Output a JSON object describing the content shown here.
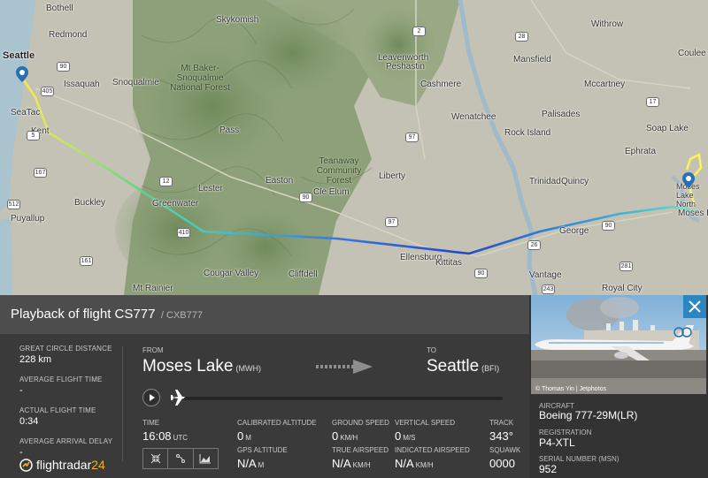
{
  "map": {
    "cities": [
      {
        "name": "Bothell",
        "cls": "city"
      },
      {
        "name": "Skykomish",
        "cls": "city"
      },
      {
        "name": "Redmond",
        "cls": "city"
      },
      {
        "name": "Seattle",
        "cls": "city big"
      },
      {
        "name": "Issaquah",
        "cls": "city"
      },
      {
        "name": "Snoqualmie",
        "cls": "city"
      },
      {
        "name": "SeaTac",
        "cls": "city"
      },
      {
        "name": "Kent",
        "cls": "city"
      },
      {
        "name": "Leavenworth",
        "cls": "city"
      },
      {
        "name": "Peshastin",
        "cls": "city"
      },
      {
        "name": "Cashmere",
        "cls": "city"
      },
      {
        "name": "Wenatchee",
        "cls": "city"
      },
      {
        "name": "Rock Island",
        "cls": "city"
      },
      {
        "name": "Palisades",
        "cls": "city"
      },
      {
        "name": "Withrow",
        "cls": "city"
      },
      {
        "name": "Mansfield",
        "cls": "city"
      },
      {
        "name": "Mccartney",
        "cls": "city"
      },
      {
        "name": "Soap Lake",
        "cls": "city"
      },
      {
        "name": "Coulee Cit",
        "cls": "city"
      },
      {
        "name": "Ephrata",
        "cls": "city"
      },
      {
        "name": "Trinidad",
        "cls": "city"
      },
      {
        "name": "Quincy",
        "cls": "city"
      },
      {
        "name": "Moses Lake",
        "cls": "city"
      },
      {
        "name": "Moses Lake North",
        "cls": "city"
      },
      {
        "name": "Puyallup",
        "cls": "city"
      },
      {
        "name": "Buckley",
        "cls": "city"
      },
      {
        "name": "Greenwater",
        "cls": "city"
      },
      {
        "name": "Easton",
        "cls": "city"
      },
      {
        "name": "Cle Elum",
        "cls": "city"
      },
      {
        "name": "Liberty",
        "cls": "city"
      },
      {
        "name": "Ellensburg",
        "cls": "city"
      },
      {
        "name": "Kittitas",
        "cls": "city"
      },
      {
        "name": "George",
        "cls": "city"
      },
      {
        "name": "Cougar Valley",
        "cls": "city"
      },
      {
        "name": "Cliffdell",
        "cls": "city"
      },
      {
        "name": "Mt Rainier",
        "cls": "city"
      },
      {
        "name": "Vantage",
        "cls": "city"
      },
      {
        "name": "Royal City",
        "cls": "city"
      },
      {
        "name": "Pass",
        "cls": "city"
      },
      {
        "name": "Lester",
        "cls": "city"
      }
    ],
    "forests": [
      {
        "name": "Mt Baker-Snoqualmie National Forest"
      },
      {
        "name": "Teanaway Community Forest"
      }
    ],
    "highways": [
      "90",
      "405",
      "167",
      "512",
      "410",
      "161",
      "2",
      "97",
      "28",
      "17",
      "90",
      "90",
      "281",
      "243",
      "90",
      "12",
      "5",
      "97",
      "26"
    ]
  },
  "flight": {
    "title": "Playback of flight CS777",
    "subtitle": "/ CXB777",
    "great_circle_label": "GREAT CIRCLE DISTANCE",
    "great_circle_value": "228 km",
    "avg_flight_time_label": "AVERAGE FLIGHT TIME",
    "avg_flight_time_value": "-",
    "actual_flight_time_label": "ACTUAL FLIGHT TIME",
    "actual_flight_time_value": "0:34",
    "avg_arrival_delay_label": "AVERAGE ARRIVAL DELAY",
    "avg_arrival_delay_value": "-",
    "from_label": "FROM",
    "from_city": "Moses Lake",
    "from_code": "(MWH)",
    "to_label": "TO",
    "to_city": "Seattle",
    "to_code": "(BFI)",
    "progress": 0.0
  },
  "readouts": {
    "time_label": "TIME",
    "time_value": "16:08",
    "time_unit": "UTC",
    "cal_alt_label": "CALIBRATED ALTITUDE",
    "cal_alt_value": "0",
    "cal_alt_unit": "M",
    "gps_alt_label": "GPS ALTITUDE",
    "gps_alt_value": "N/A",
    "gps_alt_unit": "M",
    "ground_speed_label": "GROUND SPEED",
    "ground_speed_value": "0",
    "ground_speed_unit": "KM/H",
    "true_airspeed_label": "TRUE AIRSPEED",
    "true_airspeed_value": "N/A",
    "true_airspeed_unit": "KM/H",
    "vertical_speed_label": "VERTICAL SPEED",
    "vertical_speed_value": "0",
    "vertical_speed_unit": "M/S",
    "indicated_airspeed_label": "INDICATED AIRSPEED",
    "indicated_airspeed_value": "N/A",
    "indicated_airspeed_unit": "KM/H",
    "track_label": "TRACK",
    "track_value": "343°",
    "squawk_label": "SQUAWK",
    "squawk_value": "0000"
  },
  "aircraft": {
    "photo_credit": "© Thomas Yin | Jetphotos",
    "aircraft_label": "AIRCRAFT",
    "aircraft_value": "Boeing 777-29M(LR)",
    "registration_label": "REGISTRATION",
    "registration_value": "P4-XTL",
    "serial_label": "SERIAL NUMBER (MSN)",
    "serial_value": "952"
  },
  "brand": {
    "name_main": "flightradar",
    "name_accent": "24"
  },
  "colors": {
    "accent": "#2b86c2",
    "brand_accent": "#f6b11c",
    "panel_bg": "#3a3a3a",
    "header_bg": "#4d4d4d"
  },
  "icons": [
    "play-icon",
    "plane-icon",
    "arrow-right-icon",
    "close-icon",
    "collapse-icon",
    "route-icon",
    "chart-icon",
    "logo-icon",
    "airport-marker-icon"
  ]
}
